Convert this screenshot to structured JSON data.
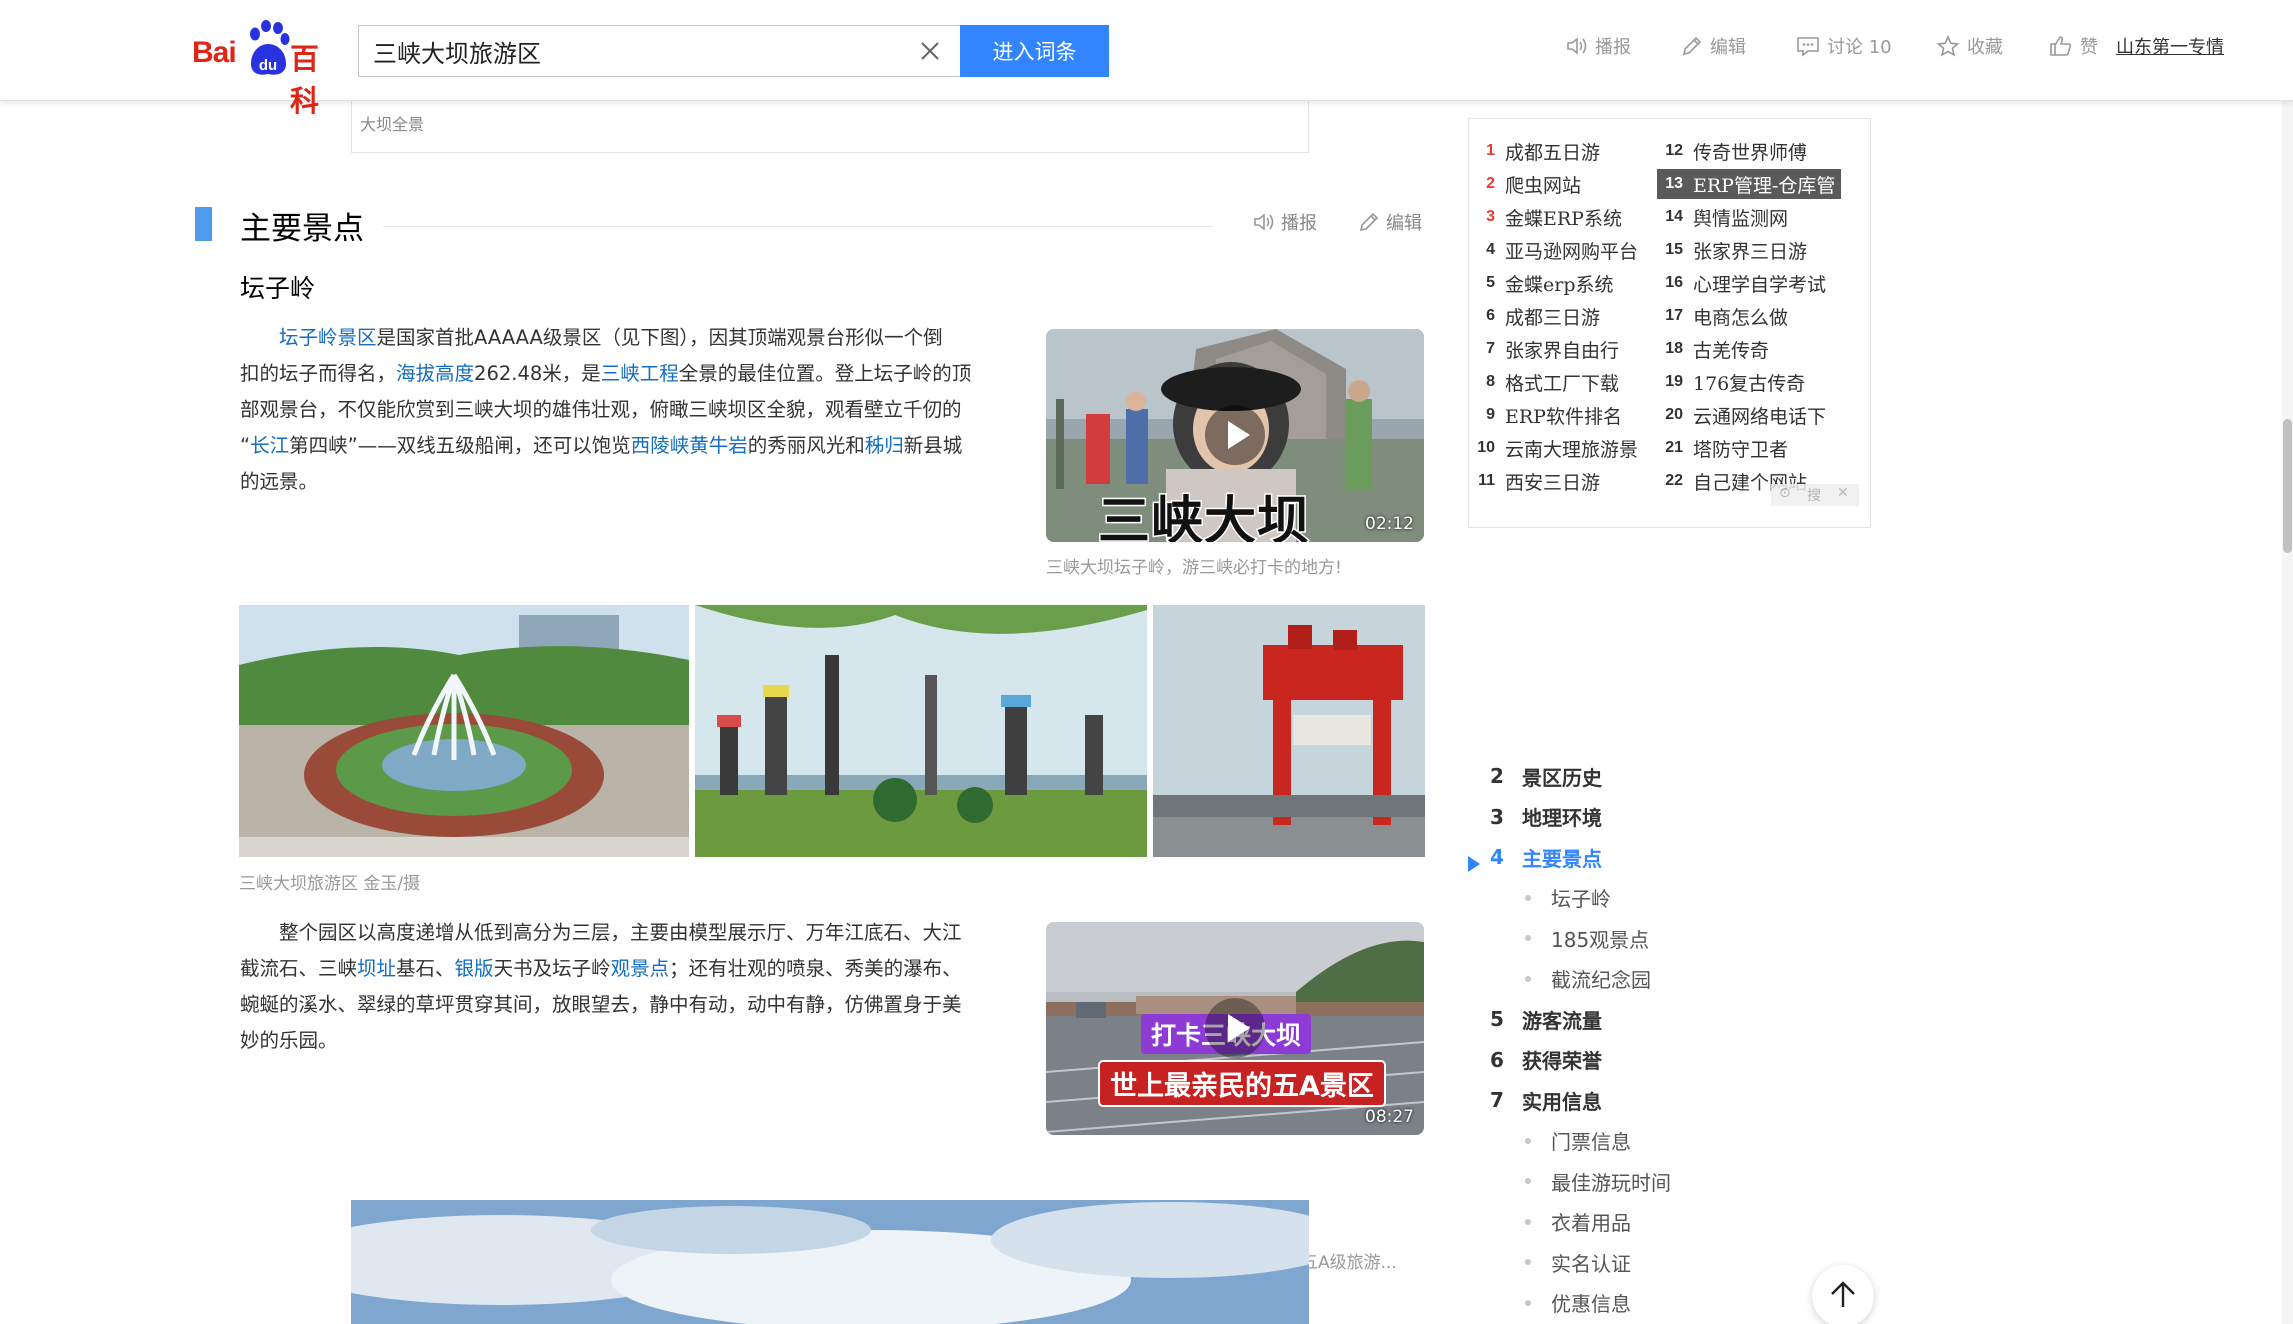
{
  "header": {
    "logo": {
      "bai": "Bai",
      "du": "du",
      "baike": "百科"
    },
    "search_value": "三峡大坝旅游区",
    "search_button": "进入词条",
    "tools": {
      "broadcast": "播报",
      "edit": "编辑",
      "discuss": "讨论 10",
      "favorite": "收藏",
      "like": "赞",
      "special": "山东第一专情"
    }
  },
  "top_caption": "大坝全景",
  "section": {
    "title": "主要景点",
    "broadcast": "播报",
    "edit": "编辑"
  },
  "subsection_title": "坛子岭",
  "para1": {
    "l1": {
      "link1": "坛子岭景区",
      "t1": "是国家首批AAAAA级景区（见下图），因其顶端观景台形似一个倒"
    },
    "l2": {
      "t1": "扣的坛子而得名，",
      "link1": "海拔高度",
      "t2": "262.48米，是",
      "link2": "三峡工程",
      "t3": "全景的最佳位置。登上坛子岭的顶"
    },
    "l3": {
      "t1": "部观景台，不仅能欣赏到三峡大坝的雄伟壮观，俯瞰三峡坝区全貌，观看壁立千仞的"
    },
    "l4": {
      "t1": "“",
      "link1": "长江",
      "t2": "第四峡”——双线五级船闸，还可以饱览",
      "link2": "西陵峡黄牛岩",
      "t3": "的秀丽风光和",
      "link3": "秭归",
      "t4": "新县城"
    },
    "l5": {
      "t1": "的远景。"
    }
  },
  "video1": {
    "title_overlay": "三峡大坝",
    "duration": "02:12",
    "caption": "三峡大坝坛子岭，游三峡必打卡的地方!"
  },
  "gallery_caption": "三峡大坝旅游区 金玉/摄",
  "para2": {
    "l1": {
      "t1": "整个园区以高度递增从低到高分为三层，主要由模型展示厅、万年江底石、大江"
    },
    "l2": {
      "t1": "截流石、三峡",
      "link1": "坝址",
      "t2": "基石、",
      "link2": "银版",
      "t3": "天书及坛子岭",
      "link3": "观景点",
      "t4": "；还有壮观的喷泉、秀美的瀑布、"
    },
    "l3": {
      "t1": "蜿蜒的溪水、翠绿的草坪贯穿其间，放眼望去，静中有动，动中有静，仿佛置身于美"
    },
    "l4": {
      "t1": "妙的乐园。"
    }
  },
  "video2": {
    "overlay_top": "打卡三峡大坝",
    "overlay_bottom": "世上最亲民的五A景区",
    "duration": "08:27",
    "caption": "打卡三峡大坝，感受国内最亲民的五A级旅游..."
  },
  "hot_list": [
    {
      "num": "1",
      "text": "成都五日游"
    },
    {
      "num": "2",
      "text": "爬虫网站"
    },
    {
      "num": "3",
      "text": "金蝶ERP系统"
    },
    {
      "num": "4",
      "text": "亚马逊网购平台"
    },
    {
      "num": "5",
      "text": "金蝶erp系统"
    },
    {
      "num": "6",
      "text": "成都三日游"
    },
    {
      "num": "7",
      "text": "张家界自由行"
    },
    {
      "num": "8",
      "text": "格式工厂下载"
    },
    {
      "num": "9",
      "text": "ERP软件排名"
    },
    {
      "num": "10",
      "text": "云南大理旅游景"
    },
    {
      "num": "11",
      "text": "西安三日游"
    },
    {
      "num": "12",
      "text": "传奇世界师傅"
    },
    {
      "num": "13",
      "text": "ERP管理-仓库管"
    },
    {
      "num": "14",
      "text": "舆情监测网"
    },
    {
      "num": "15",
      "text": "张家界三日游"
    },
    {
      "num": "16",
      "text": "心理学自学考试"
    },
    {
      "num": "17",
      "text": "电商怎么做"
    },
    {
      "num": "18",
      "text": "古羌传奇"
    },
    {
      "num": "19",
      "text": "176复古传奇"
    },
    {
      "num": "20",
      "text": "云通网络电话下"
    },
    {
      "num": "21",
      "text": "塔防守卫者"
    },
    {
      "num": "22",
      "text": "自己建个网站"
    }
  ],
  "ad_controls": {
    "a": "⊙",
    "b": "搜",
    "c": "✕"
  },
  "toc": [
    {
      "num": "2",
      "text": "景区历史"
    },
    {
      "num": "3",
      "text": "地理环境"
    },
    {
      "num": "4",
      "text": "主要景点"
    },
    {
      "text": "坛子岭"
    },
    {
      "text": "185观景点"
    },
    {
      "text": "截流纪念园"
    },
    {
      "num": "5",
      "text": "游客流量"
    },
    {
      "num": "6",
      "text": "获得荣誉"
    },
    {
      "num": "7",
      "text": "实用信息"
    },
    {
      "text": "门票信息"
    },
    {
      "text": "最佳游玩时间"
    },
    {
      "text": "衣着用品"
    },
    {
      "text": "实名认证"
    },
    {
      "text": "优惠信息"
    }
  ],
  "colors": {
    "link": "#136ec2",
    "accent": "#3385ff",
    "section_bar": "#4f9cee",
    "brand_red": "#de2618"
  }
}
